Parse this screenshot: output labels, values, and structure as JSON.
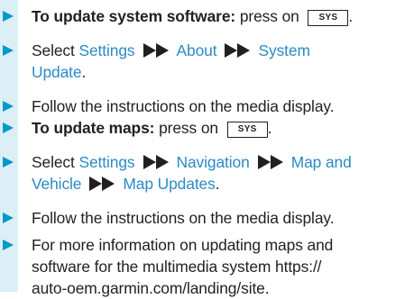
{
  "colors": {
    "accent": "#0099cc",
    "link": "#2a8bc6",
    "sidebar": "#dceef6",
    "text": "#231f20"
  },
  "icons": {
    "step": "triangle-arrow-icon",
    "separator": "double-chevron-icon"
  },
  "steps": [
    {
      "lead": "To update system software:",
      "text": " press on ",
      "key": "SYS",
      "tail": "."
    },
    {
      "text": "Select ",
      "path": [
        "Settings",
        "About",
        "System"
      ],
      "path_cont": "Update",
      "tail": "."
    },
    {
      "text": "Follow the instructions on the media display."
    },
    {
      "lead": "To update maps:",
      "text": " press on ",
      "key": "SYS",
      "tail": "."
    },
    {
      "text": "Select ",
      "path": [
        "Settings",
        "Navigation",
        "Map and"
      ],
      "path_line2": [
        "Vehicle",
        "Map Updates"
      ],
      "tail": "."
    },
    {
      "text": "Follow the instructions on the media display."
    },
    {
      "lines": [
        "For more information on updating maps and",
        "software for the multimedia system https://",
        "auto-oem.garmin.com/landing/site."
      ]
    }
  ]
}
